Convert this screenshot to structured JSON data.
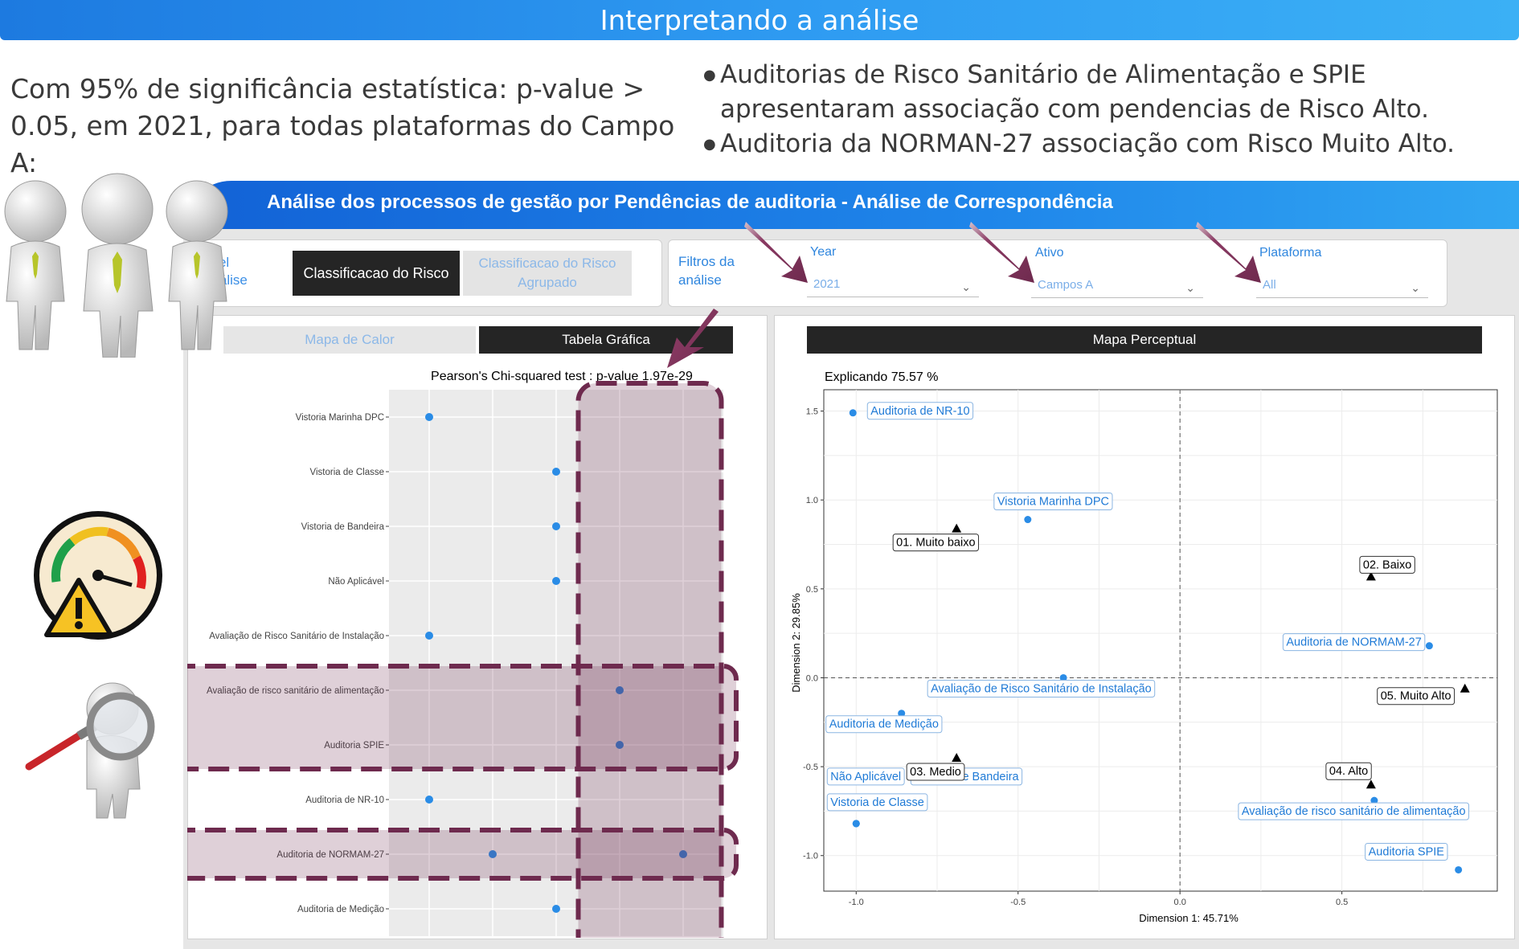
{
  "banner": {
    "title": "Interpretando a análise"
  },
  "intro": {
    "significance": "Com 95% de significância estatística: p-value > 0.05, em 2021, para todas plataformas do Campo A:"
  },
  "bullets": [
    "Auditorias de Risco Sanitário de Alimentação e SPIE apresentaram associação com pendencias de Risco Alto.",
    "Auditoria da NORMAN-27 associação com Risco Muito Alto."
  ],
  "dashboard": {
    "title": "Análise dos processos de gestão por Pendências de auditoria - Análise de Correspondência",
    "variable_label": "avel análise",
    "buttons": {
      "risk": "Classificacao do Risco",
      "risk_grouped": "Classificacao do Risco Agrupado"
    },
    "filters": {
      "label": "Filtros da análise",
      "year": {
        "label": "Year",
        "value": "2021"
      },
      "asset": {
        "label": "Ativo",
        "value": "Campos A"
      },
      "platform": {
        "label": "Plataforma",
        "value": "All"
      }
    },
    "tabs": {
      "heatmap": "Mapa de Calor",
      "table": "Tabela Gráfica"
    },
    "map_title": "Mapa Perceptual",
    "accent_color": "#2a8ce6",
    "highlight_color": "#6e2a4e"
  },
  "chart_data": [
    {
      "type": "scatter",
      "title": "Pearson's Chi-squared test : p-value  1.97e-29",
      "categories_x": [
        "01. Muito baixo",
        "02. Baixo",
        "03. Medio",
        "04. Alto",
        "05. Muito Alto"
      ],
      "categories_y": [
        "Vistoria Marinha DPC",
        "Vistoria de Classe",
        "Vistoria de Bandeira",
        "Não Aplicável",
        "Avaliação de Risco Sanitário de Instalação",
        "Avaliação de risco sanitário de alimentação",
        "Auditoria SPIE",
        "Auditoria de NR-10",
        "Auditoria de NORMAM-27",
        "Auditoria de Medição"
      ],
      "points": [
        {
          "y": "Vistoria Marinha DPC",
          "x": "01. Muito baixo"
        },
        {
          "y": "Vistoria de Classe",
          "x": "03. Medio"
        },
        {
          "y": "Vistoria de Bandeira",
          "x": "03. Medio"
        },
        {
          "y": "Não Aplicável",
          "x": "03. Medio"
        },
        {
          "y": "Avaliação de Risco Sanitário de Instalação",
          "x": "01. Muito baixo"
        },
        {
          "y": "Avaliação de risco sanitário de alimentação",
          "x": "04. Alto"
        },
        {
          "y": "Auditoria SPIE",
          "x": "04. Alto"
        },
        {
          "y": "Auditoria de NR-10",
          "x": "01. Muito baixo"
        },
        {
          "y": "Auditoria de NORMAM-27",
          "x": "02. Baixo"
        },
        {
          "y": "Auditoria de NORMAM-27",
          "x": "05. Muito Alto"
        },
        {
          "y": "Auditoria de Medição",
          "x": "03. Medio"
        }
      ],
      "highlight_columns": [
        "04. Alto",
        "05. Muito Alto"
      ],
      "highlight_rows": [
        [
          "Avaliação de risco sanitário de alimentação",
          "Auditoria SPIE"
        ],
        [
          "Auditoria de NORMAM-27"
        ]
      ]
    },
    {
      "type": "scatter",
      "title": "Explicando 75.57 %",
      "xlabel": "Dimension 1: 45.71%",
      "ylabel": "Dimension 2: 29.85%",
      "xlim": [
        -1.1,
        0.98
      ],
      "ylim": [
        -1.2,
        1.62
      ],
      "xticks": [
        -1.0,
        -0.5,
        0.0,
        0.5
      ],
      "yticks": [
        -1.0,
        -0.5,
        0.0,
        0.5,
        1.0,
        1.5
      ],
      "xtick_labels": [
        "-1.0",
        "-0.5",
        "0.0",
        "0.5"
      ],
      "ytick_labels": [
        "-1.0",
        "-0.5",
        "0.0",
        "0.5",
        "1.0",
        "1.5"
      ],
      "grid": true,
      "rows": [
        {
          "label": "Auditoria de NR-10",
          "x": -1.01,
          "y": 1.49
        },
        {
          "label": "Vistoria Marinha DPC",
          "x": -0.47,
          "y": 0.89
        },
        {
          "label": "Auditoria de NORMAM-27",
          "x": 0.77,
          "y": 0.18
        },
        {
          "label": "Avaliação de Risco Sanitário de Instalação",
          "x": -0.36,
          "y": 0.0
        },
        {
          "label": "Auditoria de Medição",
          "x": -0.86,
          "y": -0.2
        },
        {
          "label": "Avaliação de risco sanitário de alimentação",
          "x": 0.6,
          "y": -0.69
        },
        {
          "label": "Não Aplicável",
          "x": -1.0,
          "y": -0.82
        },
        {
          "label": "Vistoria de Bandeira",
          "x": -1.0,
          "y": -0.82
        },
        {
          "label": "Vistoria de Classe",
          "x": -1.0,
          "y": -0.82
        },
        {
          "label": "Auditoria SPIE",
          "x": 0.86,
          "y": -1.08
        }
      ],
      "columns": [
        {
          "label": "01. Muito baixo",
          "x": -0.69,
          "y": 0.84
        },
        {
          "label": "02. Baixo",
          "x": 0.59,
          "y": 0.57
        },
        {
          "label": "05. Muito Alto",
          "x": 0.88,
          "y": -0.06
        },
        {
          "label": "03. Medio",
          "x": -0.69,
          "y": -0.45
        },
        {
          "label": "04. Alto",
          "x": 0.59,
          "y": -0.6
        }
      ]
    }
  ]
}
